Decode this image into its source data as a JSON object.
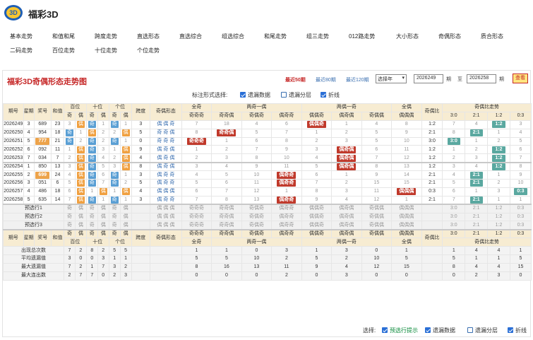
{
  "app": {
    "title": "福彩3D",
    "logo_text": "3D"
  },
  "nav": [
    {
      "label": "基本走势"
    },
    {
      "label": "和值和尾"
    },
    {
      "label": "跨度走势"
    },
    {
      "label": "直选形态"
    },
    {
      "label": "直选综合"
    },
    {
      "label": "组选综合"
    },
    {
      "label": "和尾走势"
    },
    {
      "label": "组三走势"
    },
    {
      "label": "012路走势"
    },
    {
      "label": "大小形态"
    },
    {
      "label": "奇偶形态"
    },
    {
      "label": "质合形态"
    },
    {
      "label": "二码走势"
    },
    {
      "label": "百位走势"
    },
    {
      "label": "十位走势"
    },
    {
      "label": "个位走势"
    }
  ],
  "panel": {
    "title": "福彩3D奇偶形态走势图",
    "period_links": [
      "最近50期",
      "最近80期",
      "最近120期"
    ],
    "year_select": "选择年",
    "from_value": "2026249",
    "to_value": "2026258",
    "lbl_period": "期",
    "lbl_to": "至",
    "query": "查看",
    "opts_label": "标注形式选择:",
    "opts": [
      "遗漏数据",
      "遗漏分层",
      "折线"
    ],
    "opts_checked": [
      true,
      false,
      true
    ]
  },
  "headers": {
    "row1": [
      "期号",
      "星期",
      "奖号",
      "和值",
      "百位",
      "十位",
      "个位",
      "跨度",
      "奇偶形态",
      "全奇",
      "两奇一偶",
      "两偶一奇",
      "全偶",
      "奇偶比",
      "奇偶比走势"
    ],
    "row2_digits": [
      "奇",
      "偶",
      "奇",
      "偶",
      "奇",
      "偶"
    ],
    "row2_forms": [
      "奇",
      "偶",
      "奇"
    ],
    "row2_full_odd": [
      "奇奇奇"
    ],
    "row2_two_odd": [
      "奇奇偶",
      "奇偶奇",
      "偶奇奇"
    ],
    "row2_two_even": [
      "偶偶奇",
      "偶奇偶",
      "奇偶偶"
    ],
    "row2_full_even": [
      "偶偶偶"
    ],
    "row2_ratio": [
      "3:0",
      "2:1",
      "1:2",
      "0:3"
    ]
  },
  "rows": [
    {
      "issue": "2026249",
      "week": "3",
      "num": "689",
      "sum": "23",
      "c": [
        "3",
        "偶",
        "奇",
        "1",
        "奇",
        "1"
      ],
      "span": "3",
      "forms": [
        "偶",
        "偶",
        "奇"
      ],
      "fo": "7",
      "to": [
        "18",
        "4",
        "6"
      ],
      "te": [
        "偶偶奇",
        "1",
        "4"
      ],
      "fe": "8",
      "ratio": "1:2",
      "rt": [
        "7",
        "4",
        "1:2",
        "3"
      ]
    },
    {
      "issue": "2026250",
      "week": "4",
      "num": "954",
      "sum": "18",
      "c": [
        "奇",
        "1",
        "偶",
        "2",
        "2",
        "偶"
      ],
      "span": "5",
      "forms": [
        "奇",
        "奇",
        "偶"
      ],
      "fo": "8",
      "to": [
        "奇奇偶",
        "5",
        "7"
      ],
      "te": [
        "1",
        "2",
        "5"
      ],
      "fe": "9",
      "ratio": "2:1",
      "rt": [
        "8",
        "2:1",
        "1",
        "4"
      ]
    },
    {
      "issue": "2026251",
      "week": "5",
      "num": "777",
      "sum": "21",
      "c": [
        "奇",
        "2",
        "奇",
        "2",
        "奇",
        "1"
      ],
      "span": "0",
      "forms": [
        "奇",
        "奇",
        "奇"
      ],
      "fo": "奇奇奇",
      "to": [
        "1",
        "6",
        "8"
      ],
      "te": [
        "2",
        "3",
        "5"
      ],
      "fe": "10",
      "ratio": "3:0",
      "rt": [
        "3:0",
        "1",
        "2",
        "5"
      ]
    },
    {
      "issue": "2026252",
      "week": "6",
      "num": "092",
      "sum": "11",
      "c": [
        "1",
        "偶",
        "奇",
        "3",
        "1",
        "偶"
      ],
      "span": "9",
      "forms": [
        "偶",
        "奇",
        "偶"
      ],
      "fo": "1",
      "to": [
        "2",
        "7",
        "9"
      ],
      "te": [
        "3",
        "偶奇偶",
        "6"
      ],
      "fe": "11",
      "ratio": "1:2",
      "rt": [
        "1",
        "2",
        "1:2",
        "6"
      ]
    },
    {
      "issue": "2026253",
      "week": "7",
      "num": "034",
      "sum": "7",
      "c": [
        "2",
        "偶",
        "奇",
        "4",
        "2",
        "偶"
      ],
      "span": "4",
      "forms": [
        "偶",
        "奇",
        "偶"
      ],
      "fo": "2",
      "to": [
        "3",
        "8",
        "10"
      ],
      "te": [
        "4",
        "偶奇偶",
        "7"
      ],
      "fe": "12",
      "ratio": "1:2",
      "rt": [
        "2",
        "3",
        "1:2",
        "7"
      ]
    },
    {
      "issue": "2026254",
      "week": "1",
      "num": "850",
      "sum": "13",
      "c": [
        "3",
        "偶",
        "奇",
        "5",
        "3",
        "偶"
      ],
      "span": "8",
      "forms": [
        "偶",
        "奇",
        "偶"
      ],
      "fo": "3",
      "to": [
        "4",
        "9",
        "11"
      ],
      "te": [
        "5",
        "偶奇偶",
        "8"
      ],
      "fe": "13",
      "ratio": "1:2",
      "rt": [
        "3",
        "4",
        "1:2",
        "8"
      ]
    },
    {
      "issue": "2026255",
      "week": "2",
      "num": "699",
      "sum": "24",
      "c": [
        "4",
        "偶",
        "奇",
        "6",
        "奇",
        "1"
      ],
      "span": "3",
      "forms": [
        "偶",
        "奇",
        "奇"
      ],
      "fo": "4",
      "to": [
        "5",
        "10",
        "偶奇奇"
      ],
      "te": [
        "6",
        "1",
        "9"
      ],
      "fe": "14",
      "ratio": "2:1",
      "rt": [
        "4",
        "2:1",
        "1",
        "9"
      ]
    },
    {
      "issue": "2026256",
      "week": "3",
      "num": "051",
      "sum": "6",
      "c": [
        "5",
        "偶",
        "奇",
        "7",
        "奇",
        "2"
      ],
      "span": "5",
      "forms": [
        "偶",
        "奇",
        "奇"
      ],
      "fo": "5",
      "to": [
        "6",
        "11",
        "偶奇奇"
      ],
      "te": [
        "7",
        "2",
        "15"
      ],
      "fe": "15",
      "ratio": "2:1",
      "rt": [
        "5",
        "2:1",
        "2",
        "10"
      ]
    },
    {
      "issue": "2026257",
      "week": "4",
      "num": "486",
      "sum": "18",
      "c": [
        "6",
        "偶",
        "1",
        "偶",
        "1",
        "偶"
      ],
      "span": "4",
      "forms": [
        "偶",
        "偶",
        "偶"
      ],
      "fo": "6",
      "to": [
        "7",
        "12",
        "1"
      ],
      "te": [
        "8",
        "3",
        "11"
      ],
      "fe": "偶偶偶",
      "ratio": "0:3",
      "rt": [
        "6",
        "1",
        "3",
        "0:3"
      ]
    },
    {
      "issue": "2026258",
      "week": "5",
      "num": "635",
      "sum": "14",
      "c": [
        "7",
        "偶",
        "奇",
        "1",
        "奇",
        "1"
      ],
      "span": "3",
      "forms": [
        "偶",
        "奇",
        "奇"
      ],
      "fo": "7",
      "to": [
        "8",
        "13",
        "偶奇奇"
      ],
      "te": [
        "9",
        "4",
        "12"
      ],
      "fe": "1",
      "ratio": "2:1",
      "rt": [
        "7",
        "2:1",
        "1",
        "1"
      ]
    }
  ],
  "predict": {
    "labels": [
      "预选行1",
      "预选行2",
      "预选行3"
    ],
    "digits": [
      "奇",
      "偶",
      "奇",
      "偶",
      "奇",
      "偶"
    ],
    "forms": [
      "偶",
      "偶",
      "偶"
    ],
    "fo": "奇奇奇",
    "to": [
      "奇奇偶",
      "奇偶奇",
      "偶奇奇"
    ],
    "te": [
      "偶偶奇",
      "偶奇偶",
      "奇偶偶"
    ],
    "fe": "偶偶偶",
    "ratio": [
      "3:0",
      "2:1",
      "1:2",
      "0:3"
    ]
  },
  "footer": {
    "head1": [
      "期号",
      "星期",
      "奖号",
      "和值",
      "奇",
      "偶",
      "奇",
      "偶",
      "奇",
      "偶",
      "跨度",
      "奇偶形态",
      "奇奇奇",
      "奇奇偶",
      "奇偶奇",
      "偶奇奇",
      "偶偶奇",
      "偶奇偶",
      "奇偶偶",
      "偶偶偶",
      "奇偶比",
      "3:0",
      "2:1",
      "1:2",
      "0:3"
    ],
    "head2": [
      "百位",
      "十位",
      "个位",
      "全奇",
      "两奇一偶",
      "两偶一奇",
      "全偶",
      "奇偶比走势"
    ],
    "stats": [
      {
        "label": "出现总次数",
        "v": [
          "7",
          "2",
          "8",
          "2",
          "5",
          "5"
        ],
        "g": [
          "1",
          "1",
          "0",
          "3",
          "1",
          "3",
          "0",
          "1",
          "1",
          "4",
          "4",
          "1"
        ]
      },
      {
        "label": "平均遗漏值",
        "v": [
          "3",
          "0",
          "0",
          "3",
          "1",
          "1"
        ],
        "g": [
          "5",
          "5",
          "10",
          "2",
          "5",
          "2",
          "10",
          "5",
          "5",
          "1",
          "1",
          "5"
        ]
      },
      {
        "label": "最大遗漏值",
        "v": [
          "7",
          "2",
          "1",
          "7",
          "3",
          "2"
        ],
        "g": [
          "8",
          "16",
          "13",
          "11",
          "9",
          "4",
          "12",
          "15",
          "8",
          "4",
          "4",
          "15"
        ]
      },
      {
        "label": "最大连出数",
        "v": [
          "2",
          "7",
          "7",
          "0",
          "2",
          "3"
        ],
        "g": [
          "0",
          "0",
          "0",
          "2",
          "0",
          "3",
          "0",
          "0",
          "0",
          "2",
          "3",
          "0"
        ]
      }
    ]
  },
  "bottom_opts": {
    "label": "选择:",
    "opts": [
      "预选行提示",
      "遗漏数据",
      "遗漏分层",
      "折线"
    ],
    "checked": [
      true,
      true,
      false,
      true
    ]
  }
}
